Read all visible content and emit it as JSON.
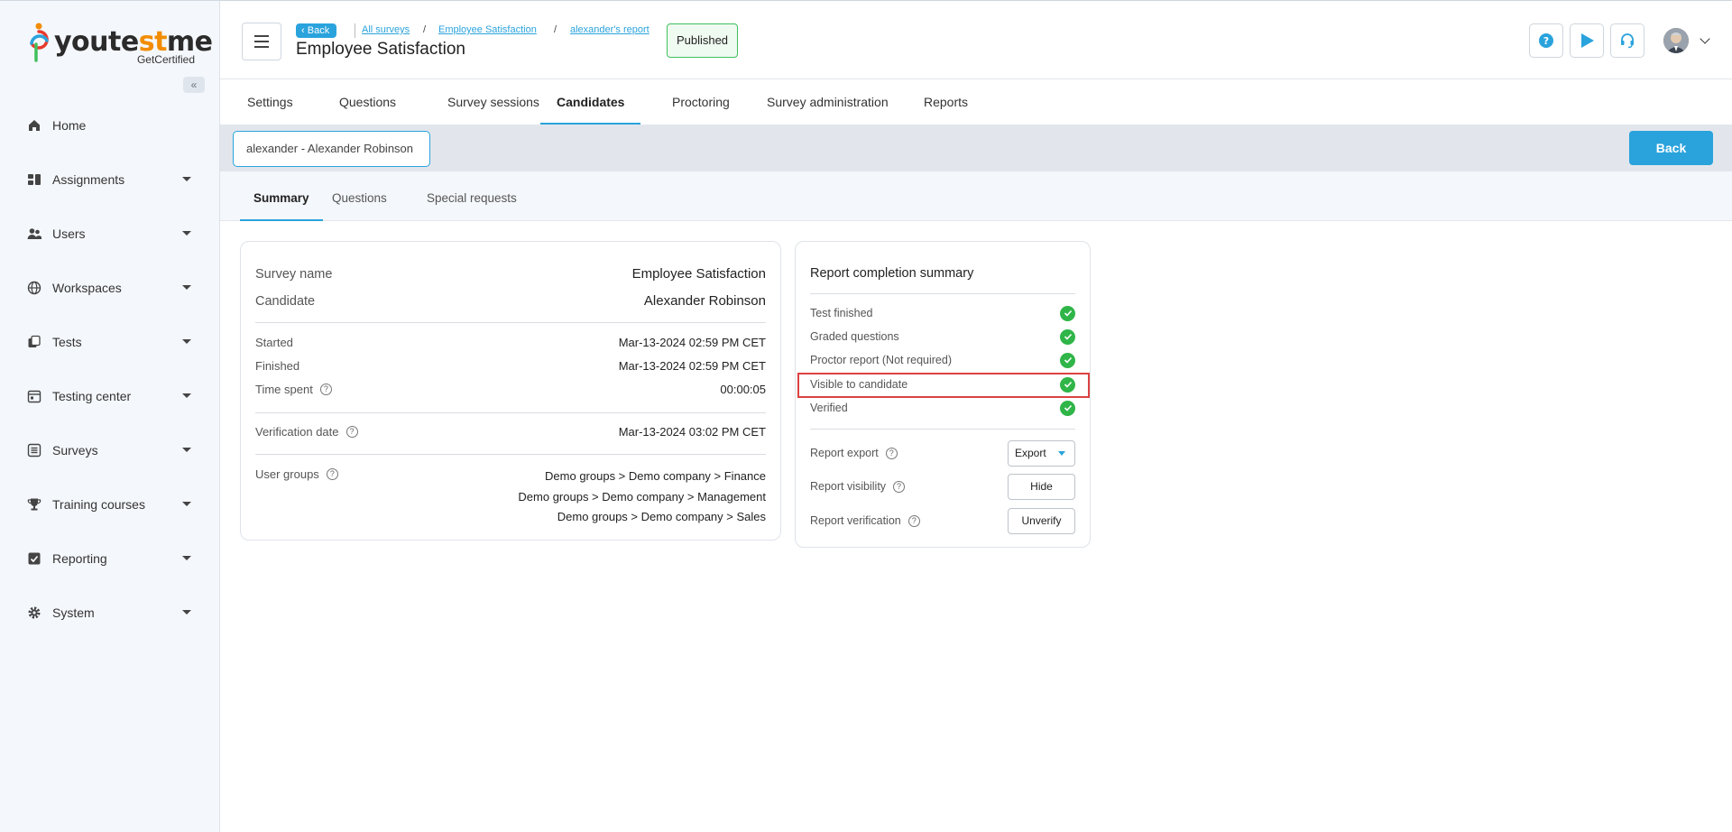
{
  "brand": {
    "name_prefix": "youte",
    "name_accent": "st",
    "name_suffix": "me",
    "tagline": "GetCertified"
  },
  "sidebar": {
    "collapse_label": "«",
    "items": [
      {
        "label": "Home",
        "icon": "home-icon"
      },
      {
        "label": "Assignments",
        "icon": "assignments-icon"
      },
      {
        "label": "Users",
        "icon": "users-icon"
      },
      {
        "label": "Workspaces",
        "icon": "globe-icon"
      },
      {
        "label": "Tests",
        "icon": "tests-icon"
      },
      {
        "label": "Testing center",
        "icon": "calendar-icon"
      },
      {
        "label": "Surveys",
        "icon": "list-icon"
      },
      {
        "label": "Training courses",
        "icon": "trophy-icon"
      },
      {
        "label": "Reporting",
        "icon": "reporting-icon"
      },
      {
        "label": "System",
        "icon": "gear-icon"
      }
    ]
  },
  "header": {
    "back_label": "Back",
    "breadcrumbs": [
      "All surveys",
      "Employee Satisfaction",
      "alexander's report"
    ],
    "separator": "/",
    "title": "Employee Satisfaction",
    "status": "Published"
  },
  "tabs": [
    "Settings",
    "Questions",
    "Survey sessions",
    "Candidates",
    "Proctoring",
    "Survey administration",
    "Reports"
  ],
  "candidate": {
    "selected": "alexander - Alexander Robinson",
    "back_label": "Back"
  },
  "subtabs": [
    "Summary",
    "Questions",
    "Special requests"
  ],
  "summary": {
    "survey_name_label": "Survey name",
    "survey_name": "Employee Satisfaction",
    "candidate_label": "Candidate",
    "candidate": "Alexander Robinson",
    "started_label": "Started",
    "started": "Mar-13-2024 02:59 PM CET",
    "finished_label": "Finished",
    "finished": "Mar-13-2024 02:59 PM CET",
    "time_spent_label": "Time spent",
    "time_spent": "00:00:05",
    "verification_date_label": "Verification date",
    "verification_date": "Mar-13-2024 03:02 PM CET",
    "user_groups_label": "User groups",
    "user_groups": [
      "Demo groups > Demo company > Finance",
      "Demo groups > Demo company > Management",
      "Demo groups > Demo company > Sales"
    ]
  },
  "report": {
    "title": "Report completion summary",
    "items": [
      "Test finished",
      "Graded questions",
      "Proctor report (Not required)",
      "Visible to candidate",
      "Verified"
    ],
    "export_label": "Report export",
    "export_button": "Export",
    "visibility_label": "Report visibility",
    "visibility_button": "Hide",
    "verification_label": "Report verification",
    "verification_button": "Unverify"
  },
  "help_glyph": "?",
  "colors": {
    "accent": "#2aa3dc",
    "success": "#2fb548",
    "highlight": "#dc4242",
    "brand_orange": "#f28c00"
  }
}
